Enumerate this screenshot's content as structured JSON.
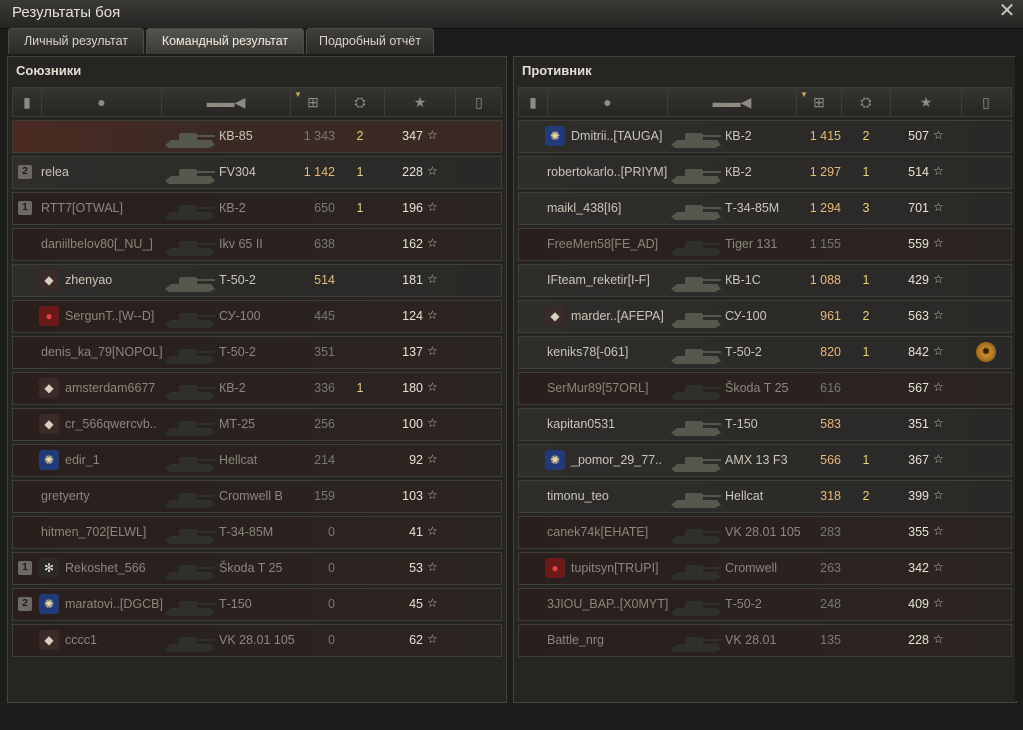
{
  "window": {
    "title": "Результаты боя",
    "close_icon": "close-icon"
  },
  "tabs": [
    {
      "label": "Личный результат",
      "active": false
    },
    {
      "label": "Командный результат",
      "active": true
    },
    {
      "label": "Подробный отчёт",
      "active": false
    }
  ],
  "colors": {
    "accent": "#c8a552",
    "killed": "#e8d080",
    "damage_alive": "#e8b878",
    "damage_dead": "#7b786f"
  },
  "columns": {
    "icons": [
      "rank-icon",
      "player-icon",
      "tank-icon",
      "damage-icon",
      "kills-icon",
      "xp-star-icon",
      "medal-icon"
    ],
    "sorted_column": "damage-icon"
  },
  "allies": {
    "title": "Союзники",
    "rows": [
      {
        "badge": "",
        "clan": "",
        "name": "",
        "tank": "КВ-85",
        "damage": "1 343",
        "kills": "2",
        "xp": "347",
        "medal": false,
        "state": "player"
      },
      {
        "badge": "2",
        "clan": "",
        "name": "relea",
        "tank": "FV304",
        "damage": "1 142",
        "kills": "1",
        "xp": "228",
        "medal": false,
        "state": "alive"
      },
      {
        "badge": "1",
        "clan": "",
        "name": "RTT7[OTWAL]",
        "tank": "КВ-2",
        "damage": "650",
        "kills": "1",
        "xp": "196",
        "medal": false,
        "state": "dead"
      },
      {
        "badge": "",
        "clan": "",
        "name": "daniilbelov80[_NU_]",
        "tank": "Ikv 65 II",
        "damage": "638",
        "kills": "",
        "xp": "162",
        "medal": false,
        "state": "dead"
      },
      {
        "badge": "",
        "clan": "diamond",
        "name": "zhenyao",
        "tank": "Т-50-2",
        "damage": "514",
        "kills": "",
        "xp": "181",
        "medal": false,
        "state": "alive"
      },
      {
        "badge": "",
        "clan": "red-circle",
        "name": "SergunT..[W--D]",
        "tank": "СУ-100",
        "damage": "445",
        "kills": "",
        "xp": "124",
        "medal": false,
        "state": "dead"
      },
      {
        "badge": "",
        "clan": "",
        "name": "denis_ka_79[NOPOL]",
        "tank": "Т-50-2",
        "damage": "351",
        "kills": "",
        "xp": "137",
        "medal": false,
        "state": "dead"
      },
      {
        "badge": "",
        "clan": "diamond",
        "name": "amsterdam6677",
        "tank": "КВ-2",
        "damage": "336",
        "kills": "1",
        "xp": "180",
        "medal": false,
        "state": "dead"
      },
      {
        "badge": "",
        "clan": "diamond",
        "name": "cr_566qwercvb..",
        "tank": "МТ-25",
        "damage": "256",
        "kills": "",
        "xp": "100",
        "medal": false,
        "state": "dead"
      },
      {
        "badge": "",
        "clan": "flag-star",
        "name": "edir_1",
        "tank": "Hellcat",
        "damage": "214",
        "kills": "",
        "xp": "92",
        "medal": false,
        "state": "dead"
      },
      {
        "badge": "",
        "clan": "",
        "name": "gretyerty",
        "tank": "Cromwell B",
        "damage": "159",
        "kills": "",
        "xp": "103",
        "medal": false,
        "state": "dead"
      },
      {
        "badge": "",
        "clan": "",
        "name": "hitmen_702[ELWL]",
        "tank": "Т-34-85М",
        "damage": "0",
        "kills": "",
        "xp": "41",
        "medal": false,
        "state": "dead"
      },
      {
        "badge": "1",
        "clan": "snowflake",
        "name": "Rekoshet_566",
        "tank": "Škoda T 25",
        "damage": "0",
        "kills": "",
        "xp": "53",
        "medal": false,
        "state": "dead"
      },
      {
        "badge": "2",
        "clan": "flag-star",
        "name": "maratovi..[DGCB]",
        "tank": "Т-150",
        "damage": "0",
        "kills": "",
        "xp": "45",
        "medal": false,
        "state": "dead"
      },
      {
        "badge": "",
        "clan": "diamond",
        "name": "cccc1",
        "tank": "VK 28.01 105",
        "damage": "0",
        "kills": "",
        "xp": "62",
        "medal": false,
        "state": "dead"
      }
    ]
  },
  "enemies": {
    "title": "Противник",
    "rows": [
      {
        "badge": "",
        "clan": "flag-star",
        "name": "Dmitrii..[TAUGA]",
        "tank": "КВ-2",
        "damage": "1 415",
        "kills": "2",
        "xp": "507",
        "medal": false,
        "state": "alive"
      },
      {
        "badge": "",
        "clan": "",
        "name": "robertokarlo..[PRIYM]",
        "tank": "КВ-2",
        "damage": "1 297",
        "kills": "1",
        "xp": "514",
        "medal": false,
        "state": "alive"
      },
      {
        "badge": "",
        "clan": "",
        "name": "maikl_438[I6]",
        "tank": "Т-34-85М",
        "damage": "1 294",
        "kills": "3",
        "xp": "701",
        "medal": false,
        "state": "alive"
      },
      {
        "badge": "",
        "clan": "",
        "name": "FreeMen58[FE_AD]",
        "tank": "Tiger 131",
        "damage": "1 155",
        "kills": "",
        "xp": "559",
        "medal": false,
        "state": "dead"
      },
      {
        "badge": "",
        "clan": "",
        "name": "IFteam_reketir[I-F]",
        "tank": "КВ-1С",
        "damage": "1 088",
        "kills": "1",
        "xp": "429",
        "medal": false,
        "state": "alive"
      },
      {
        "badge": "",
        "clan": "diamond",
        "name": "marder..[AFEPA]",
        "tank": "СУ-100",
        "damage": "961",
        "kills": "2",
        "xp": "563",
        "medal": false,
        "state": "alive"
      },
      {
        "badge": "",
        "clan": "",
        "name": "keniks78[-061]",
        "tank": "Т-50-2",
        "damage": "820",
        "kills": "1",
        "xp": "842",
        "medal": true,
        "state": "alive"
      },
      {
        "badge": "",
        "clan": "",
        "name": "SerMur89[57ORL]",
        "tank": "Škoda T 25",
        "damage": "616",
        "kills": "",
        "xp": "567",
        "medal": false,
        "state": "dead"
      },
      {
        "badge": "",
        "clan": "",
        "name": "kapitan0531",
        "tank": "Т-150",
        "damage": "583",
        "kills": "",
        "xp": "351",
        "medal": false,
        "state": "alive"
      },
      {
        "badge": "",
        "clan": "flag-star",
        "name": "_pomor_29_77..",
        "tank": "AMX 13 F3",
        "damage": "566",
        "kills": "1",
        "xp": "367",
        "medal": false,
        "state": "alive"
      },
      {
        "badge": "",
        "clan": "",
        "name": "timonu_teo",
        "tank": "Hellcat",
        "damage": "318",
        "kills": "2",
        "xp": "399",
        "medal": false,
        "state": "alive"
      },
      {
        "badge": "",
        "clan": "",
        "name": "canek74k[EHATE]",
        "tank": "VK 28.01 105",
        "damage": "283",
        "kills": "",
        "xp": "355",
        "medal": false,
        "state": "dead"
      },
      {
        "badge": "",
        "clan": "red-circle",
        "name": "tupitsyn[TRUPI]",
        "tank": "Cromwell",
        "damage": "263",
        "kills": "",
        "xp": "342",
        "medal": false,
        "state": "dead"
      },
      {
        "badge": "",
        "clan": "",
        "name": "3JIOU_BAP..[X0MYT]",
        "tank": "Т-50-2",
        "damage": "248",
        "kills": "",
        "xp": "409",
        "medal": false,
        "state": "dead"
      },
      {
        "badge": "",
        "clan": "",
        "name": "Battle_nrg",
        "tank": "VK 28.01",
        "damage": "135",
        "kills": "",
        "xp": "228",
        "medal": false,
        "state": "dead"
      }
    ]
  }
}
